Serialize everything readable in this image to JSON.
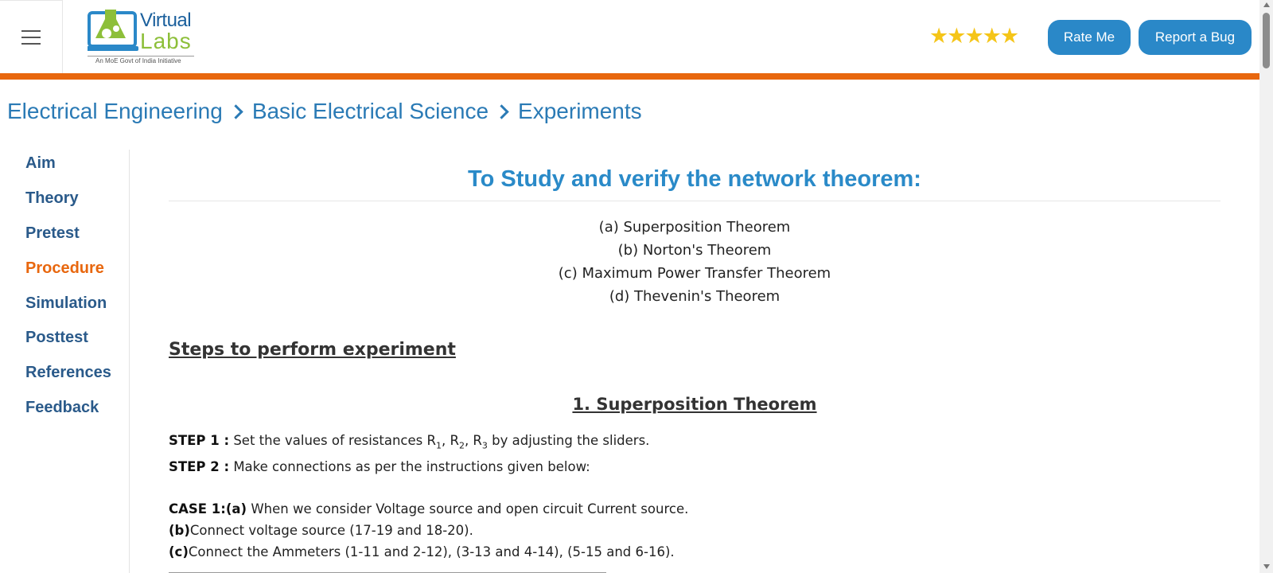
{
  "header": {
    "logo": {
      "virtual": "Virtual",
      "labs": "Labs",
      "tagline": "An MoE Govt of India Initiative"
    },
    "rating_stars": 5,
    "rate_label": "Rate Me",
    "bug_label": "Report a Bug"
  },
  "breadcrumb": [
    "Electrical Engineering",
    "Basic Electrical Science",
    "Experiments"
  ],
  "sidebar": {
    "items": [
      {
        "label": "Aim"
      },
      {
        "label": "Theory"
      },
      {
        "label": "Pretest"
      },
      {
        "label": "Procedure",
        "active": true
      },
      {
        "label": "Simulation"
      },
      {
        "label": "Posttest"
      },
      {
        "label": "References"
      },
      {
        "label": "Feedback"
      }
    ]
  },
  "content": {
    "title": "To Study and verify the network theorem:",
    "theorems": [
      "(a) Superposition Theorem",
      "(b) Norton's Theorem",
      "(c) Maximum Power Transfer Theorem",
      "(d) Thevenin's Theorem"
    ],
    "steps_heading": "Steps to perform experiment",
    "section1_heading": "1. Superposition Theorem",
    "step1_label": "STEP 1 :",
    "step1_text_a": " Set the values of resistances R",
    "step1_r1": "1",
    "step1_sep1": ", R",
    "step1_r2": "2",
    "step1_sep2": ", R",
    "step1_r3": "3",
    "step1_text_b": " by adjusting the sliders.",
    "step2_label": "STEP 2 :",
    "step2_text": " Make connections as per the instructions given below:",
    "case1_label": "CASE 1:(a)",
    "case1_text": " When we consider Voltage source and open circuit Current source.",
    "b_label": "(b)",
    "b_text": "Connect voltage source (17-19 and 18-20).",
    "c_label": "(c)",
    "c_text": "Connect the Ammeters (1-11 and 2-12), (3-13 and 4-14), (5-15 and 6-16)."
  },
  "colors": {
    "accent_orange": "#e8670e",
    "link_blue": "#2a7ab5",
    "button_blue": "#2a88c8",
    "star_gold": "#f5c518"
  }
}
